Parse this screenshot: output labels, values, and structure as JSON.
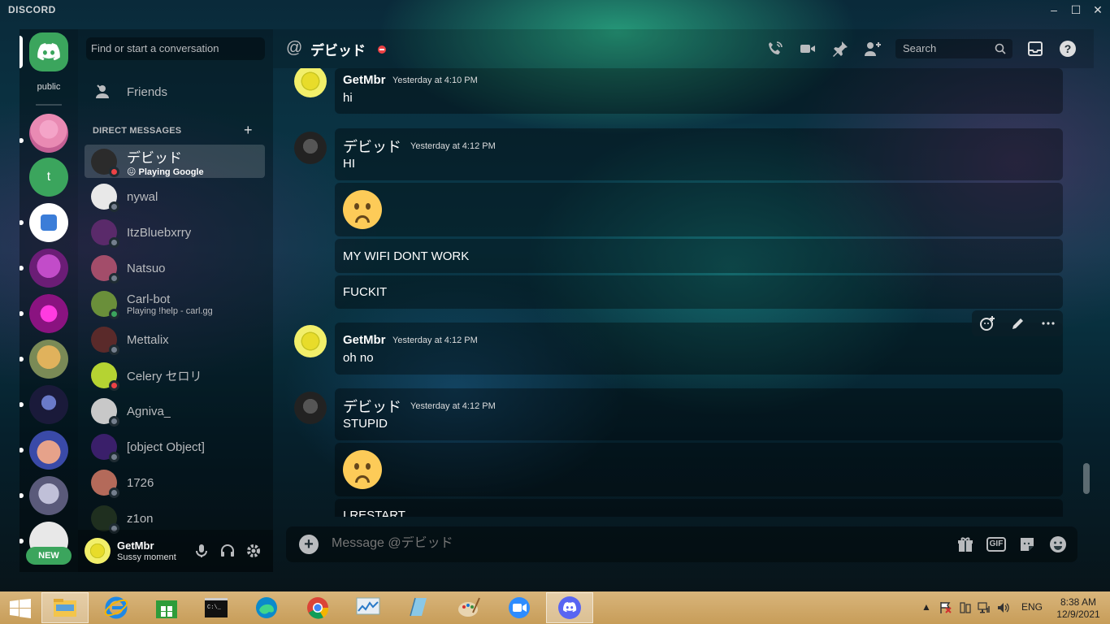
{
  "app": {
    "title": "DISCORD"
  },
  "window_controls": {
    "minimize": "–",
    "maximize": "☐",
    "close": "✕"
  },
  "servers": {
    "home_label": "public",
    "t_server_letter": "t",
    "new_badge": "NEW"
  },
  "sidebar": {
    "search_placeholder": "Find or start a conversation",
    "friends_label": "Friends",
    "dm_header": "DIRECT MESSAGES",
    "dm_add": "+",
    "dms": [
      {
        "name": "デビッド",
        "sub": "😖 Playing Google",
        "status": "dnd",
        "color": "#2b2b2b",
        "active": true
      },
      {
        "name": "nywal",
        "sub": "",
        "status": "offline",
        "color": "#e8e8e8"
      },
      {
        "name": "ItzBluebxrry",
        "sub": "",
        "status": "offline",
        "color": "#5a2a6a"
      },
      {
        "name": "Natsuo",
        "sub": "",
        "status": "offline",
        "color": "#a34d6a"
      },
      {
        "name": "Carl-bot",
        "sub": "Playing !help - carl.gg",
        "status": "online",
        "color": "#6a8f3a"
      },
      {
        "name": "Mettalix",
        "sub": "",
        "status": "offline",
        "color": "#5a2a2a"
      },
      {
        "name": "Celery セロリ",
        "sub": "",
        "status": "dnd",
        "color": "#b5d332"
      },
      {
        "name": "Agniva_",
        "sub": "",
        "status": "offline",
        "color": "#c8c8c8"
      },
      {
        "name": "[object Object]",
        "sub": "",
        "status": "offline",
        "color": "#3a1f6a"
      },
      {
        "name": "1726",
        "sub": "",
        "status": "offline",
        "color": "#b46a5a"
      },
      {
        "name": "z1on",
        "sub": "",
        "status": "offline",
        "color": "#1f2f1f"
      }
    ]
  },
  "user_panel": {
    "name": "GetMbr",
    "status": "Sussy moment"
  },
  "chat_header": {
    "at": "@",
    "name": "デビッド",
    "search_placeholder": "Search"
  },
  "messages": {
    "groups": [
      {
        "author": "GetMbr",
        "time": "Yesterday at 4:10 PM",
        "lines": [
          "hi"
        ]
      },
      {
        "author": "デビッド",
        "time": "Yesterday at 4:12 PM",
        "lines": [
          "HI",
          "MY  WIFI DONT WORK",
          "FUCKIT"
        ]
      },
      {
        "author": "GetMbr",
        "time": "Yesterday at 4:12 PM",
        "lines": [
          "oh no"
        ]
      },
      {
        "author": "デビッド",
        "time": "Yesterday at 4:12 PM",
        "lines": [
          "STUPID",
          "I RESTART"
        ]
      }
    ],
    "emoji_name": "frowning-face"
  },
  "composer": {
    "placeholder": "Message @デビッド",
    "gif_label": "GIF"
  },
  "taskbar": {
    "lang": "ENG",
    "time": "8:38 AM",
    "date": "12/9/2021"
  },
  "colors": {
    "accent_green": "#3ba55d",
    "dnd_red": "#ed4245",
    "offline_gray": "#747f8d",
    "online_green": "#3ba55d"
  }
}
